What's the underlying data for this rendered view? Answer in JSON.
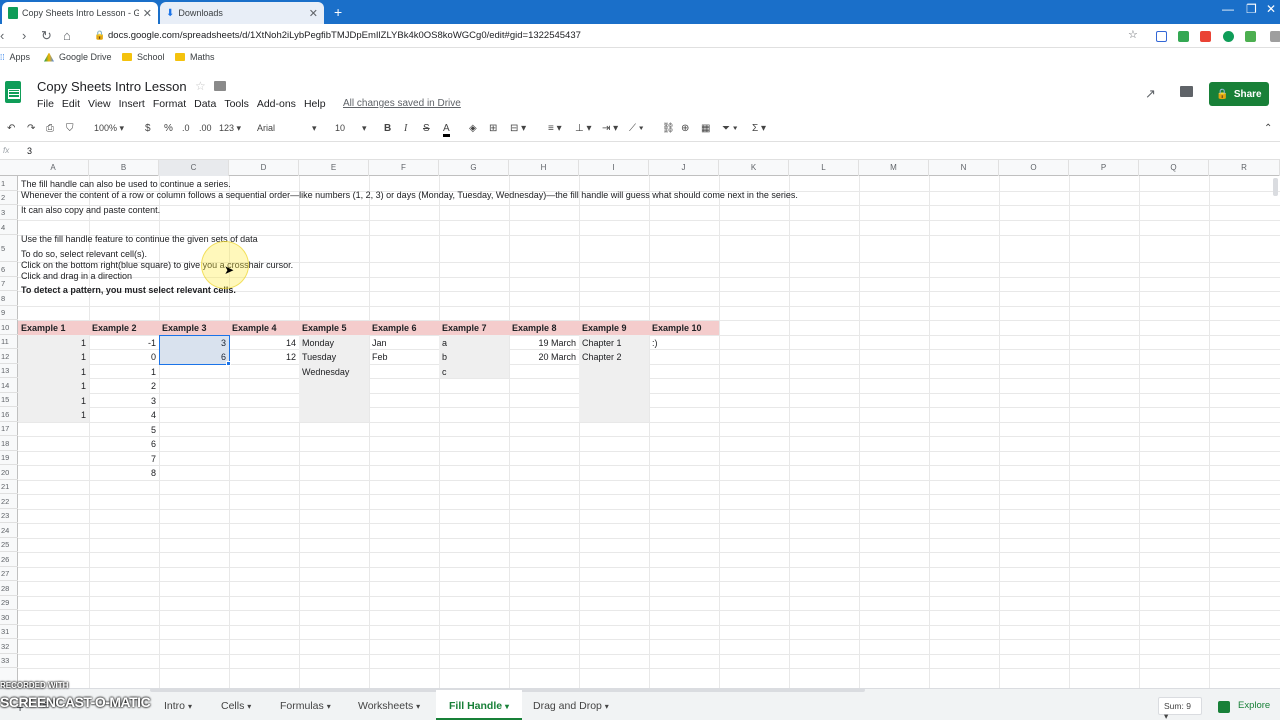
{
  "browser": {
    "tabs": [
      {
        "title": "Copy Sheets Intro Lesson - Goog",
        "active": true
      },
      {
        "title": "Downloads",
        "active": false
      }
    ],
    "url": "docs.google.com/spreadsheets/d/1XtNoh2iLybPegfibTMJDpEmIlZLYBk4k0OS8koWGCg0/edit#gid=1322545437",
    "bookmarks": [
      "Apps",
      "Google Drive",
      "School",
      "Maths"
    ]
  },
  "doc": {
    "title": "Copy Sheets Intro Lesson",
    "menu": [
      "File",
      "Edit",
      "View",
      "Insert",
      "Format",
      "Data",
      "Tools",
      "Add-ons",
      "Help"
    ],
    "saved": "All changes saved in Drive",
    "share": "Share"
  },
  "toolbar": {
    "zoom": "100%",
    "currency": "$",
    "percent": "%",
    "dec_less": ".0",
    "dec_more": ".00",
    "more_formats": "123",
    "font": "Arial",
    "size": "10",
    "bold": "B",
    "italic": "I",
    "strike": "S",
    "color": "A"
  },
  "formula": {
    "label": "fx",
    "value": "3"
  },
  "columns": [
    "A",
    "B",
    "C",
    "D",
    "E",
    "F",
    "G",
    "H",
    "I",
    "J",
    "K",
    "L",
    "M",
    "N",
    "O",
    "P",
    "Q",
    "R"
  ],
  "rows": [
    "1",
    "2",
    "3",
    "4",
    "5",
    "6",
    "7",
    "8",
    "9",
    "10",
    "11",
    "12",
    "13",
    "14",
    "15",
    "16",
    "17",
    "18",
    "19",
    "20",
    "21",
    "22",
    "23",
    "24",
    "25",
    "26",
    "27",
    "28",
    "29",
    "30",
    "31",
    "32",
    "33"
  ],
  "text": {
    "r1a": "The fill handle can also be used to continue a series.",
    "r1b": "Whenever the content of a row or column follows a sequential order—like numbers (1, 2, 3) or days (Monday, Tuesday, Wednesday)—the fill handle will guess what should come next in the series.",
    "r2": "It can also copy and paste content.",
    "r4": "Use the fill handle feature to continue the given sets of data",
    "r5a": "To do so, select relevant cell(s).",
    "r5b": "Click on the bottom right(blue square) to give you a crosshair cursor.",
    "r5c": "Click and drag in a direction",
    "r6": "To detect a pattern, you must select relevant cells."
  },
  "examples": {
    "headers": [
      "Example 1",
      "Example 2",
      "Example 3",
      "Example 4",
      "Example 5",
      "Example 6",
      "Example 7",
      "Example 8",
      "Example 9",
      "Example 10"
    ],
    "ex1": [
      "1",
      "1",
      "1",
      "1",
      "1",
      "1"
    ],
    "ex2": [
      "-1",
      "0",
      "1",
      "2",
      "3",
      "4",
      "5",
      "6",
      "7",
      "8"
    ],
    "ex3": [
      "3",
      "6"
    ],
    "ex4": [
      "14",
      "12"
    ],
    "ex5": [
      "Monday",
      "Tuesday",
      "Wednesday"
    ],
    "ex6": [
      "Jan",
      "Feb"
    ],
    "ex7": [
      "a",
      "b",
      "c"
    ],
    "ex8": [
      "19 March",
      "20 March"
    ],
    "ex9": [
      "Chapter 1",
      "Chapter 2"
    ],
    "ex10": [
      ":)"
    ]
  },
  "sheets": [
    "Intro",
    "Cells",
    "Formulas",
    "Worksheets",
    "Fill Handle",
    "Drag and Drop"
  ],
  "active_sheet": "Fill Handle",
  "status": {
    "sum": "Sum: 9",
    "explore": "Explore"
  },
  "watermark": {
    "line1": "RECORDED WITH",
    "line2": "SCREENCAST-O-MATIC"
  }
}
